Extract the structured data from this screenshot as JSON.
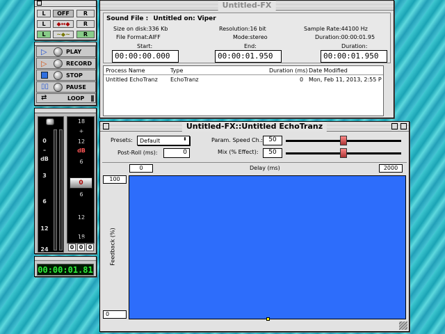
{
  "transport": {
    "row1": {
      "l": "L",
      "mode": "OFF",
      "r": "R"
    },
    "row2": {
      "l": "L",
      "r": "R"
    },
    "row3": {
      "l": "L",
      "r": "R"
    },
    "play": "PLAY",
    "record": "RECORD",
    "stop": "STOP",
    "pause": "PAUSE",
    "loop": "LOOP",
    "timecode": "00:00:01.81"
  },
  "meters": {
    "left_scale": [
      "0",
      "–",
      "dB",
      "3",
      "6",
      "12",
      "24"
    ],
    "right_scale": [
      "18",
      "+",
      "12",
      "dB",
      "6",
      "0",
      "6",
      "12",
      "18"
    ],
    "slider_value": "0",
    "channel_labels": [
      "L",
      "LR",
      "R"
    ],
    "channel_values": [
      "0",
      "0",
      "0"
    ]
  },
  "fx_window": {
    "title": "Untitled-FX",
    "sound_file_label": "Sound File :",
    "sound_file_value": "Untitled on: Viper",
    "size": "Size on disk:336 Kb",
    "resolution": "Resolution:16 bit",
    "sample_rate": "Sample Rate:44100 Hz",
    "format": "File Format:AIFF",
    "mode": "Mode:stereo",
    "duration": "Duration:00:00:01.95",
    "start_label": "Start:",
    "start_value": "00:00:00.000",
    "end_label": "End:",
    "end_value": "00:00:01.950",
    "dur_label": "Duration:",
    "dur_value": "00:00:01.950",
    "columns": [
      "Process Name",
      "Type",
      "Duration (ms)",
      "Date Modified"
    ],
    "rows": [
      {
        "name": "Untitled EchoTranz",
        "type": "EchoTranz",
        "duration": "0",
        "date": "Mon, Feb 11, 2013, 2:55 P"
      }
    ]
  },
  "echo_window": {
    "title": "Untitled-FX::Untitled EchoTranz",
    "presets_label": "Presets:",
    "preset_value": "Default",
    "postroll_label": "Post-Roll (ms):",
    "postroll_value": "0",
    "param_label": "Param. Speed Ch.:",
    "param_value": "50",
    "mix_label": "Mix (% Effect):",
    "mix_value": "50",
    "delay_min": "0",
    "delay_label": "Delay (ms)",
    "delay_max": "2000",
    "feedback_max": "100",
    "feedback_label": "Feedback (%)",
    "feedback_min": "0",
    "plot_color": "#2d6dfb"
  }
}
